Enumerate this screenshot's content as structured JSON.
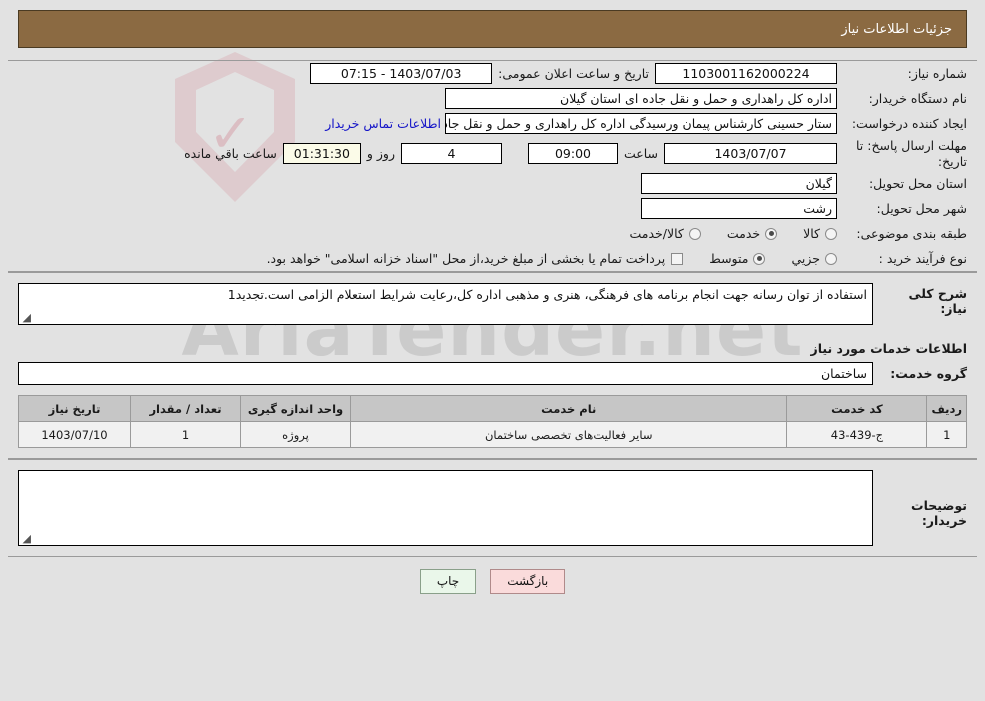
{
  "header": {
    "title": "جزئیات اطلاعات نیاز"
  },
  "watermark": {
    "text": "AriaTender.net"
  },
  "form": {
    "need_number": {
      "label": "شماره نیاز:",
      "value": "1103001162000224"
    },
    "announce_datetime": {
      "label": "تاریخ و ساعت اعلان عمومی:",
      "value": "1403/07/03 - 07:15"
    },
    "buyer_org": {
      "label": "نام دستگاه خریدار:",
      "value": "اداره کل راهداری و حمل و نقل جاده ای استان گیلان"
    },
    "request_creator": {
      "label": "ایجاد کننده درخواست:",
      "value": "ستار حسینی کارشناس پیمان ورسیدگی اداره کل راهداری و حمل و نقل جاده ای"
    },
    "contact_link": "اطلاعات تماس خریدار",
    "deadline": {
      "label": "مهلت ارسال پاسخ: تا تاریخ:",
      "date": "1403/07/07",
      "time_label": "ساعت",
      "time": "09:00",
      "days": "4",
      "days_label": "روز و",
      "countdown": "01:31:30",
      "countdown_label": "ساعت باقي مانده"
    },
    "delivery_province": {
      "label": "استان محل تحویل:",
      "value": "گیلان"
    },
    "delivery_city": {
      "label": "شهر محل تحویل:",
      "value": "رشت"
    },
    "subject_category": {
      "label": "طبقه بندی موضوعی:",
      "options": [
        {
          "label": "کالا",
          "selected": false
        },
        {
          "label": "خدمت",
          "selected": true
        },
        {
          "label": "کالا/خدمت",
          "selected": false
        }
      ]
    },
    "purchase_process": {
      "label": "نوع فرآیند خرید :",
      "options": [
        {
          "label": "جزیي",
          "selected": false
        },
        {
          "label": "متوسط",
          "selected": true
        }
      ],
      "treasury_checkbox": false,
      "treasury_text": "پرداخت تمام یا بخشی از مبلغ خرید،از محل \"اسناد خزانه اسلامی\" خواهد بود."
    }
  },
  "description": {
    "label": "شرح کلی نیاز:",
    "value": "استفاده از توان رسانه جهت انجام برنامه های فرهنگی، هنری و مذهبی اداره کل،رعایت شرایط استعلام الزامی است.تجدید1"
  },
  "services_section": {
    "heading": "اطلاعات خدمات مورد نیاز",
    "group_label": "گروه خدمت:",
    "group_value": "ساختمان",
    "table": {
      "columns": [
        "ردیف",
        "کد خدمت",
        "نام خدمت",
        "واحد اندازه گیری",
        "تعداد / مقدار",
        "تاریخ نیاز"
      ],
      "rows": [
        {
          "radif": "1",
          "code": "ج-439-43",
          "name": "سایر فعالیت‌های تخصصی ساختمان",
          "unit": "پروژه",
          "qty": "1",
          "date": "1403/07/10"
        }
      ]
    }
  },
  "comments": {
    "label": "توضیحات خریدار:",
    "value": ""
  },
  "footer": {
    "print_label": "چاپ",
    "back_label": "بازگشت"
  },
  "colors": {
    "header_bg": "#8b6a42",
    "page_bg": "#e2e2e2",
    "link": "#1414c8",
    "table_header_bg": "#c6c6c6",
    "table_row_bg": "#f1f1f1",
    "print_btn_bg": "#eaf7ea",
    "back_btn_bg": "#fadbdb",
    "countdown_bg": "#fbfbe8"
  }
}
